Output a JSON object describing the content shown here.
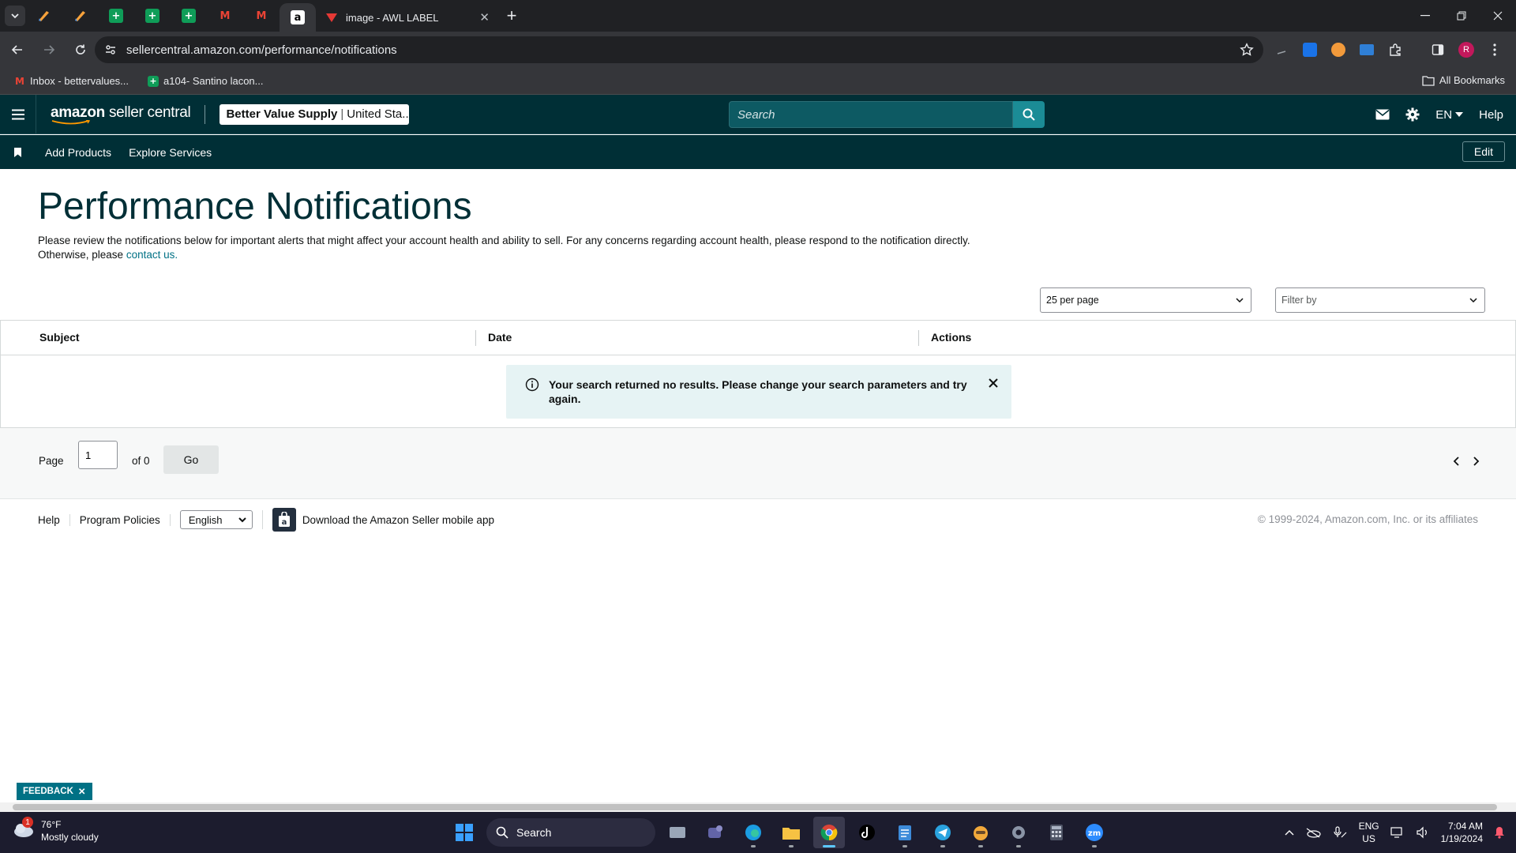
{
  "browser": {
    "active_tab_title": "image - AWL LABEL",
    "url": "sellercentral.amazon.com/performance/notifications",
    "bookmarks": [
      {
        "label": "Inbox - bettervalues..."
      },
      {
        "label": "a104- Santino lacon..."
      }
    ],
    "all_bookmarks_label": "All Bookmarks",
    "profile_initial": "R"
  },
  "header": {
    "logo_amazon": "amazon",
    "logo_product": "seller central",
    "store_name": "Better Value Supply",
    "store_marketplace": "United Sta...",
    "search_placeholder": "Search",
    "language": "EN",
    "help_label": "Help"
  },
  "nav": {
    "links": [
      "Add Products",
      "Explore Services"
    ],
    "edit_label": "Edit"
  },
  "main": {
    "title": "Performance Notifications",
    "description": "Please review the notifications below for important alerts that might affect your account health and ability to sell. For any concerns regarding account health, please respond to the notification directly. Otherwise, please",
    "contact_link": "contact us.",
    "per_page": "25 per page",
    "filter_placeholder": "Filter by",
    "columns": [
      "Subject",
      "Date",
      "Actions"
    ],
    "alert_message": "Your search returned no results. Please change your search parameters and try again."
  },
  "pagination": {
    "page_label": "Page",
    "current_page": "1",
    "of_label": "of 0",
    "go_label": "Go"
  },
  "footer": {
    "help": "Help",
    "program_policies": "Program Policies",
    "language": "English",
    "app_download": "Download the Amazon Seller mobile app",
    "copyright": "© 1999-2024, Amazon.com, Inc. or its affiliates"
  },
  "feedback_label": "FEEDBACK",
  "taskbar": {
    "weather_temp": "76°F",
    "weather_desc": "Mostly cloudy",
    "weather_badge": "1",
    "search_label": "Search",
    "lang_top": "ENG",
    "lang_bottom": "US",
    "time": "7:04 AM",
    "date": "1/19/2024"
  },
  "colors": {
    "header_bg": "#002f36",
    "accent": "#007185",
    "search_btn": "#1b8c96",
    "alert_bg": "#e6f3f4"
  }
}
